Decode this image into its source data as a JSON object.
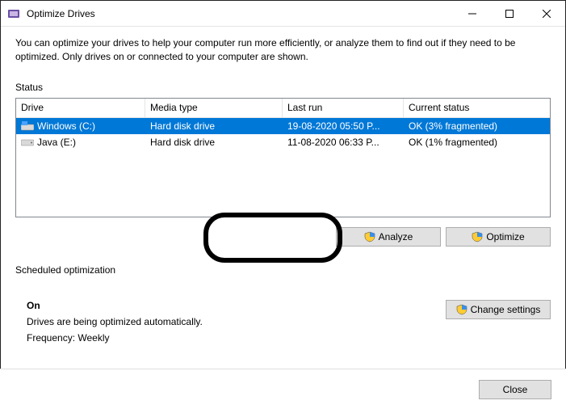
{
  "window": {
    "title": "Optimize Drives"
  },
  "intro": "You can optimize your drives to help your computer run more efficiently, or analyze them to find out if they need to be optimized. Only drives on or connected to your computer are shown.",
  "status_label": "Status",
  "columns": {
    "drive": "Drive",
    "media": "Media type",
    "last": "Last run",
    "status": "Current status"
  },
  "rows": [
    {
      "drive": "Windows (C:)",
      "media": "Hard disk drive",
      "last": "19-08-2020 05:50 P...",
      "status": "OK (3% fragmented)",
      "selected": true,
      "icon": "os"
    },
    {
      "drive": "Java (E:)",
      "media": "Hard disk drive",
      "last": "11-08-2020 06:33 P...",
      "status": "OK (1% fragmented)",
      "selected": false,
      "icon": "hd"
    }
  ],
  "buttons": {
    "analyze": "Analyze",
    "optimize": "Optimize",
    "change": "Change settings",
    "close": "Close"
  },
  "schedule": {
    "label": "Scheduled optimization",
    "on": "On",
    "line1": "Drives are being optimized automatically.",
    "line2": "Frequency: Weekly"
  }
}
